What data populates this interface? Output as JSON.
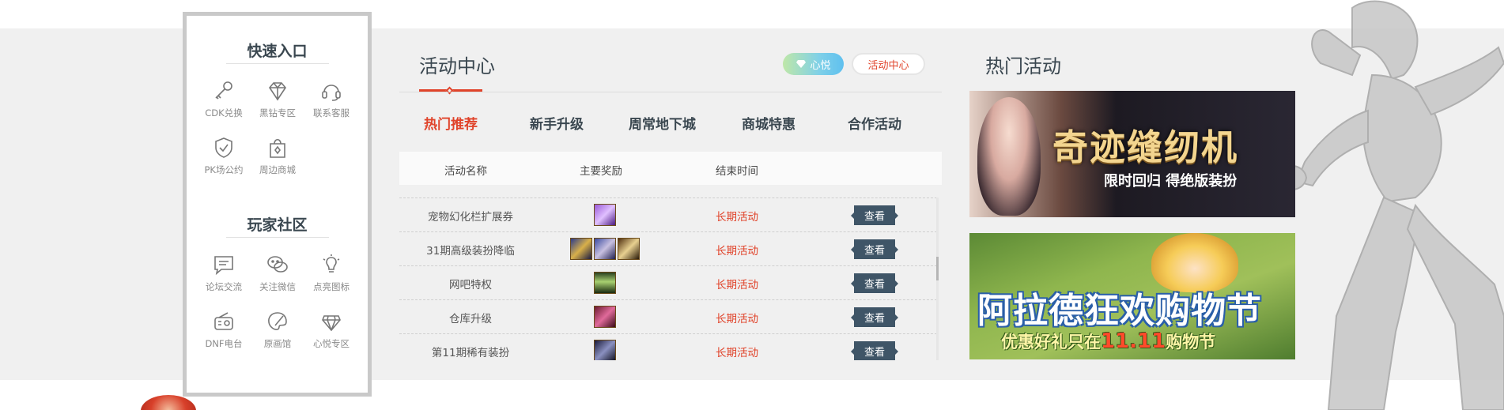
{
  "quick_entry": {
    "title": "快速入口",
    "items": [
      {
        "label": "CDK兑换",
        "icon": "key-icon"
      },
      {
        "label": "黑钻专区",
        "icon": "diamond-icon"
      },
      {
        "label": "联系客服",
        "icon": "headset-icon"
      },
      {
        "label": "PK场公约",
        "icon": "shield-icon"
      },
      {
        "label": "周边商城",
        "icon": "shopping-bag-icon"
      }
    ]
  },
  "community": {
    "title": "玩家社区",
    "items": [
      {
        "label": "论坛交流",
        "icon": "forum-icon"
      },
      {
        "label": "关注微信",
        "icon": "wechat-icon"
      },
      {
        "label": "点亮图标",
        "icon": "lightbulb-icon"
      },
      {
        "label": "DNF电台",
        "icon": "radio-icon"
      },
      {
        "label": "原画馆",
        "icon": "palette-icon"
      },
      {
        "label": "心悦专区",
        "icon": "gem-icon"
      }
    ]
  },
  "activity_center": {
    "title": "活动中心",
    "pill_xinyue": "心悦",
    "pill_activity": "活动中心",
    "tabs": [
      "热门推荐",
      "新手升级",
      "周常地下城",
      "商城特惠",
      "合作活动"
    ],
    "active_tab": "热门推荐",
    "columns": [
      "活动名称",
      "主要奖励",
      "结束时间"
    ],
    "rows": [
      {
        "name": "宠物幻化栏扩展券",
        "end": "长期活动",
        "action": "查看"
      },
      {
        "name": "31期高级装扮降临",
        "end": "长期活动",
        "action": "查看"
      },
      {
        "name": "网吧特权",
        "end": "长期活动",
        "action": "查看"
      },
      {
        "name": "仓库升级",
        "end": "长期活动",
        "action": "查看"
      },
      {
        "name": "第11期稀有装扮",
        "end": "长期活动",
        "action": "查看"
      }
    ]
  },
  "hot_activities": {
    "title": "热门活动",
    "banners": [
      {
        "title": "奇迹缝纫机",
        "subtitle": "限时回归 得绝版装扮"
      },
      {
        "title": "阿拉德狂欢购物节",
        "subtitle_pre": "优惠好礼只在",
        "subtitle_em": "11.11",
        "subtitle_post": "购物节"
      }
    ]
  },
  "colors": {
    "accent_red": "#e0432a",
    "title_navy": "#3a4750",
    "button_slate": "#3f5567"
  }
}
